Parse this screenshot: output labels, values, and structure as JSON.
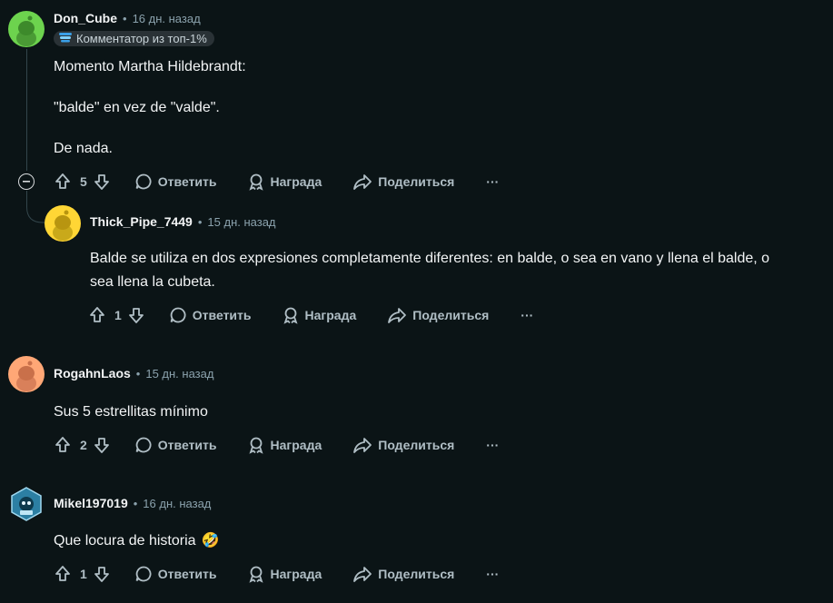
{
  "comments": [
    {
      "username": "Don_Cube",
      "time": "16 дн. назад",
      "badge": "Комментатор из топ-1%",
      "paragraphs": [
        "Momento Martha Hildebrandt:",
        "\"balde\" en vez de \"valde\".",
        "De nada."
      ],
      "votes": "5",
      "avatar_color": "#6dd34e"
    },
    {
      "username": "Thick_Pipe_7449",
      "time": "15 дн. назад",
      "paragraphs": [
        "Balde se utiliza en dos expresiones completamente diferentes: en balde, o sea en vano y llena el balde, o",
        "sea llena la cubeta."
      ],
      "votes": "1",
      "avatar_color": "#ffd635"
    },
    {
      "username": "RogahnLaos",
      "time": "15 дн. назад",
      "paragraphs": [
        "Sus 5 estrellitas mínimo"
      ],
      "votes": "2",
      "avatar_color": "#ffa776"
    },
    {
      "username": "Mikel197019",
      "time": "16 дн. назад",
      "paragraphs": [
        "Que locura de historia"
      ],
      "votes": "1",
      "emoji": "🤣"
    }
  ],
  "labels": {
    "reply": "Ответить",
    "award": "Награда",
    "share": "Поделиться",
    "more": "···",
    "dot": "•"
  }
}
